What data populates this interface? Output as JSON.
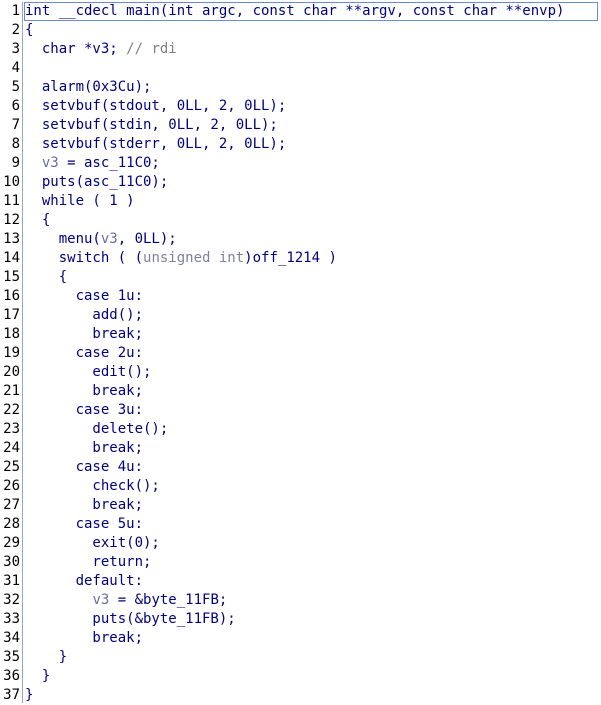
{
  "editor": {
    "lines": [
      {
        "n": "1",
        "segments": [
          {
            "t": "int __cdecl main(int argc, const char **argv, const char **envp)",
            "c": "c-kw"
          }
        ]
      },
      {
        "n": "2",
        "segments": [
          {
            "t": "{",
            "c": "c-kw"
          }
        ]
      },
      {
        "n": "3",
        "segments": [
          {
            "t": "  char *v3; ",
            "c": "c-kw"
          },
          {
            "t": "// rdi",
            "c": "c-cmt"
          }
        ]
      },
      {
        "n": "4",
        "segments": []
      },
      {
        "n": "5",
        "segments": [
          {
            "t": "  alarm(0x3Cu);",
            "c": "c-kw"
          }
        ]
      },
      {
        "n": "6",
        "segments": [
          {
            "t": "  setvbuf(stdout, 0LL, 2, 0LL);",
            "c": "c-kw"
          }
        ]
      },
      {
        "n": "7",
        "segments": [
          {
            "t": "  setvbuf(stdin, 0LL, 2, 0LL);",
            "c": "c-kw"
          }
        ]
      },
      {
        "n": "8",
        "segments": [
          {
            "t": "  setvbuf(stderr, 0LL, 2, 0LL);",
            "c": "c-kw"
          }
        ]
      },
      {
        "n": "9",
        "segments": [
          {
            "t": "  ",
            "c": "c-kw"
          },
          {
            "t": "v3",
            "c": "c-var"
          },
          {
            "t": " = asc_11C0;",
            "c": "c-kw"
          }
        ]
      },
      {
        "n": "10",
        "segments": [
          {
            "t": "  puts(asc_11C0);",
            "c": "c-kw"
          }
        ]
      },
      {
        "n": "11",
        "segments": [
          {
            "t": "  while ( 1 )",
            "c": "c-kw"
          }
        ]
      },
      {
        "n": "12",
        "segments": [
          {
            "t": "  {",
            "c": "c-kw"
          }
        ]
      },
      {
        "n": "13",
        "segments": [
          {
            "t": "    menu(",
            "c": "c-kw"
          },
          {
            "t": "v3",
            "c": "c-var"
          },
          {
            "t": ", 0LL);",
            "c": "c-kw"
          }
        ]
      },
      {
        "n": "14",
        "segments": [
          {
            "t": "    switch ( (",
            "c": "c-kw"
          },
          {
            "t": "unsigned int",
            "c": "c-type"
          },
          {
            "t": ")off_1214 )",
            "c": "c-kw"
          }
        ]
      },
      {
        "n": "15",
        "segments": [
          {
            "t": "    {",
            "c": "c-kw"
          }
        ]
      },
      {
        "n": "16",
        "segments": [
          {
            "t": "      case 1u:",
            "c": "c-kw"
          }
        ]
      },
      {
        "n": "17",
        "segments": [
          {
            "t": "        add();",
            "c": "c-kw"
          }
        ]
      },
      {
        "n": "18",
        "segments": [
          {
            "t": "        break;",
            "c": "c-kw"
          }
        ]
      },
      {
        "n": "19",
        "segments": [
          {
            "t": "      case 2u:",
            "c": "c-kw"
          }
        ]
      },
      {
        "n": "20",
        "segments": [
          {
            "t": "        edit();",
            "c": "c-kw"
          }
        ]
      },
      {
        "n": "21",
        "segments": [
          {
            "t": "        break;",
            "c": "c-kw"
          }
        ]
      },
      {
        "n": "22",
        "segments": [
          {
            "t": "      case 3u:",
            "c": "c-kw"
          }
        ]
      },
      {
        "n": "23",
        "segments": [
          {
            "t": "        delete();",
            "c": "c-kw"
          }
        ]
      },
      {
        "n": "24",
        "segments": [
          {
            "t": "        break;",
            "c": "c-kw"
          }
        ]
      },
      {
        "n": "25",
        "segments": [
          {
            "t": "      case 4u:",
            "c": "c-kw"
          }
        ]
      },
      {
        "n": "26",
        "segments": [
          {
            "t": "        check();",
            "c": "c-kw"
          }
        ]
      },
      {
        "n": "27",
        "segments": [
          {
            "t": "        break;",
            "c": "c-kw"
          }
        ]
      },
      {
        "n": "28",
        "segments": [
          {
            "t": "      case 5u:",
            "c": "c-kw"
          }
        ]
      },
      {
        "n": "29",
        "segments": [
          {
            "t": "        exit(0);",
            "c": "c-kw"
          }
        ]
      },
      {
        "n": "30",
        "segments": [
          {
            "t": "        return;",
            "c": "c-kw"
          }
        ]
      },
      {
        "n": "31",
        "segments": [
          {
            "t": "      default:",
            "c": "c-kw"
          }
        ]
      },
      {
        "n": "32",
        "segments": [
          {
            "t": "        ",
            "c": "c-kw"
          },
          {
            "t": "v3",
            "c": "c-var"
          },
          {
            "t": " = &byte_11FB;",
            "c": "c-kw"
          }
        ]
      },
      {
        "n": "33",
        "segments": [
          {
            "t": "        puts(&byte_11FB);",
            "c": "c-kw"
          }
        ]
      },
      {
        "n": "34",
        "segments": [
          {
            "t": "        break;",
            "c": "c-kw"
          }
        ]
      },
      {
        "n": "35",
        "segments": [
          {
            "t": "    }",
            "c": "c-kw"
          }
        ]
      },
      {
        "n": "36",
        "segments": [
          {
            "t": "  }",
            "c": "c-kw"
          }
        ]
      },
      {
        "n": "37",
        "segments": [
          {
            "t": "}",
            "c": "c-kw"
          }
        ]
      }
    ],
    "colors": {
      "keyword": "#000080",
      "variable": "#6a6aa8",
      "comment": "#808080",
      "type": "#7f7f9f",
      "line_number": "#000000",
      "gutter_border": "#9aa6c8",
      "current_line_border": "#6a8ad4"
    }
  }
}
